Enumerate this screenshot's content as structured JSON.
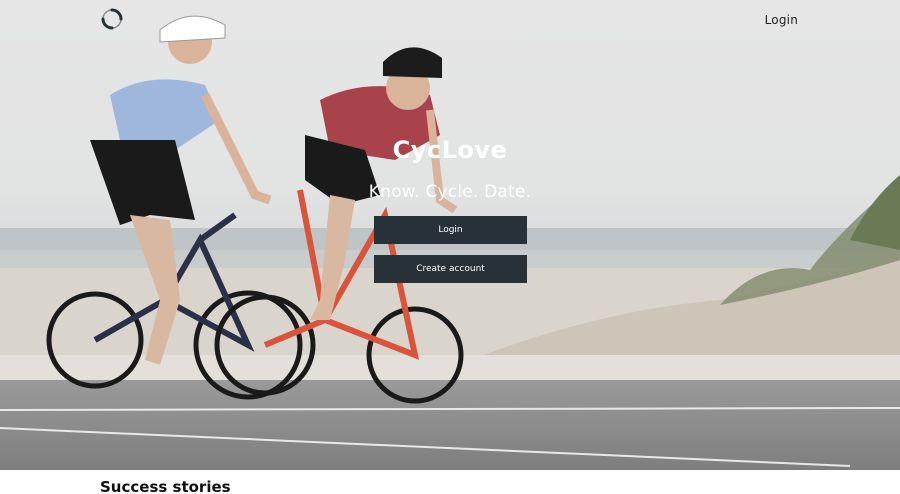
{
  "header": {
    "logo_icon": "circular-arrows-logo",
    "login_label": "Login"
  },
  "hero": {
    "brand": "CycLove",
    "tagline": "Know. Cycle. Date.",
    "login_button": "Login",
    "create_account_button": "Create account"
  },
  "sections": {
    "success_title": "Success stories"
  },
  "colors": {
    "button_bg": "#263238",
    "text_light": "#ffffff"
  }
}
